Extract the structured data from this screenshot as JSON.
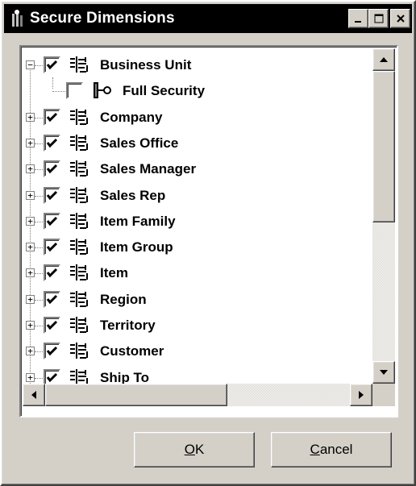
{
  "window": {
    "title": "Secure Dimensions",
    "colors": {
      "titlebar": "#000000",
      "face": "#d4d0c8",
      "tree_bg": "#ffffff"
    }
  },
  "tree": {
    "items": [
      {
        "label": "Business Unit",
        "checked": true,
        "expander": "−",
        "icon": "dimension-icon",
        "level": 0
      },
      {
        "label": "Full Security",
        "checked": false,
        "expander": "",
        "icon": "security-key-icon",
        "level": 1
      },
      {
        "label": "Company",
        "checked": true,
        "expander": "+",
        "icon": "dimension-icon",
        "level": 0
      },
      {
        "label": "Sales Office",
        "checked": true,
        "expander": "+",
        "icon": "dimension-icon",
        "level": 0
      },
      {
        "label": "Sales Manager",
        "checked": true,
        "expander": "+",
        "icon": "dimension-icon",
        "level": 0
      },
      {
        "label": "Sales Rep",
        "checked": true,
        "expander": "+",
        "icon": "dimension-icon",
        "level": 0
      },
      {
        "label": "Item Family",
        "checked": true,
        "expander": "+",
        "icon": "dimension-icon",
        "level": 0
      },
      {
        "label": "Item Group",
        "checked": true,
        "expander": "+",
        "icon": "dimension-icon",
        "level": 0
      },
      {
        "label": "Item",
        "checked": true,
        "expander": "+",
        "icon": "dimension-icon",
        "level": 0
      },
      {
        "label": "Region",
        "checked": true,
        "expander": "+",
        "icon": "dimension-icon",
        "level": 0
      },
      {
        "label": "Territory",
        "checked": true,
        "expander": "+",
        "icon": "dimension-icon",
        "level": 0
      },
      {
        "label": "Customer",
        "checked": true,
        "expander": "+",
        "icon": "dimension-icon",
        "level": 0
      },
      {
        "label": "Ship To",
        "checked": true,
        "expander": "+",
        "icon": "dimension-icon",
        "level": 0
      }
    ]
  },
  "buttons": {
    "ok_mnemonic": "O",
    "ok_rest": "K",
    "cancel_mnemonic": "C",
    "cancel_rest": "ancel"
  },
  "icons": {
    "title": "user-key-icon",
    "minimize": "minimize-icon",
    "maximize": "maximize-icon",
    "close": "close-icon"
  }
}
